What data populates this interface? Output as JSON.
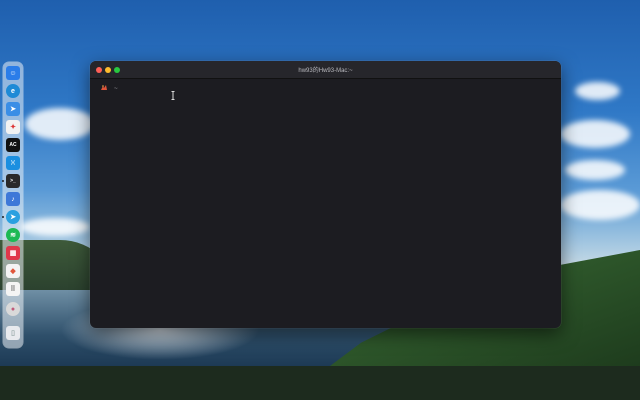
{
  "terminal": {
    "title": "hw93的Hw93-Mac:~",
    "prompt_symbol": "~"
  },
  "colors": {
    "close": "#ff5f57",
    "minimize": "#febc2e",
    "maximize": "#28c840",
    "terminal_bg": "#1c1c21"
  },
  "dock": {
    "items": [
      {
        "name": "finder-icon",
        "glyph": "☺"
      },
      {
        "name": "edge-browser-icon",
        "glyph": "e"
      },
      {
        "name": "maps-icon",
        "glyph": "➤"
      },
      {
        "name": "pinwheel-app-icon",
        "glyph": "✦"
      },
      {
        "name": "ac-app-icon",
        "glyph": "AC"
      },
      {
        "name": "vscode-icon",
        "glyph": "⟩⟨"
      },
      {
        "name": "terminal-app-icon",
        "glyph": ">_"
      },
      {
        "name": "music-app-icon",
        "glyph": "♪"
      },
      {
        "name": "telegram-icon",
        "glyph": "➤"
      },
      {
        "name": "spotify-icon",
        "glyph": "≋"
      },
      {
        "name": "stats-app-icon",
        "glyph": "▦"
      },
      {
        "name": "colorful-app-icon",
        "glyph": "◆"
      },
      {
        "name": "launchpad-icon",
        "glyph": "⠿"
      },
      {
        "name": "photo-app-icon",
        "glyph": "●"
      },
      {
        "name": "trash-icon",
        "glyph": "▯"
      }
    ]
  }
}
